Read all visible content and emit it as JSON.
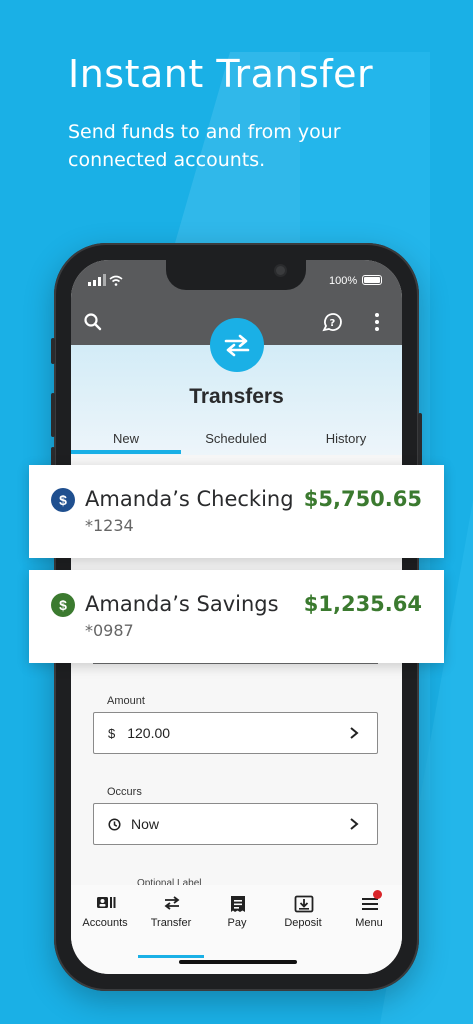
{
  "promo": {
    "headline": "Instant Transfer",
    "subheadline": "Send funds to and from your connected accounts."
  },
  "status_bar": {
    "battery": "100%"
  },
  "header": {
    "title": "Transfers",
    "icons": [
      "search-icon",
      "help-chat-icon",
      "more-vertical-icon"
    ]
  },
  "tabs": [
    {
      "label": "New",
      "active": true
    },
    {
      "label": "Scheduled",
      "active": false
    },
    {
      "label": "History",
      "active": false
    }
  ],
  "accounts": [
    {
      "name": "Amanda’s Checking",
      "number": "*1234",
      "balance": "$5,750.65",
      "icon_color": "#1f4f8f"
    },
    {
      "name": "Amanda’s Savings",
      "number": "*0987",
      "balance": "$1,235.64",
      "icon_color": "#3b7a2f"
    }
  ],
  "form": {
    "amount_label": "Amount",
    "amount_prefix": "$",
    "amount_value": "120.00",
    "occurs_label": "Occurs",
    "occurs_value": "Now",
    "optional_label": "Optional Label"
  },
  "bottom_nav": [
    {
      "label": "Accounts",
      "icon": "accounts-icon",
      "active": false
    },
    {
      "label": "Transfer",
      "icon": "transfer-icon",
      "active": true
    },
    {
      "label": "Pay",
      "icon": "pay-icon",
      "active": false
    },
    {
      "label": "Deposit",
      "icon": "deposit-icon",
      "active": false
    },
    {
      "label": "Menu",
      "icon": "menu-icon",
      "active": false,
      "badge": true
    }
  ],
  "colors": {
    "background": "#1ab0e6",
    "accent": "#1ab0e6",
    "balance_green": "#3b7a2f",
    "checking_icon": "#1f4f8f",
    "notification_badge": "#d9252a"
  }
}
